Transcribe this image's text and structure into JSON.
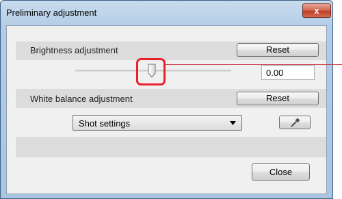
{
  "window": {
    "title": "Preliminary adjustment",
    "close_glyph": "x"
  },
  "brightness": {
    "label": "Brightness adjustment",
    "reset_label": "Reset",
    "value": "0.00",
    "slider_fraction": 0.49
  },
  "white_balance": {
    "label": "White balance adjustment",
    "reset_label": "Reset",
    "selected_option": "Shot settings",
    "picker_icon": "eyedropper-icon"
  },
  "footer": {
    "close_label": "Close"
  },
  "colors": {
    "highlight": "#e8202a",
    "title_close": "#c7452f"
  }
}
